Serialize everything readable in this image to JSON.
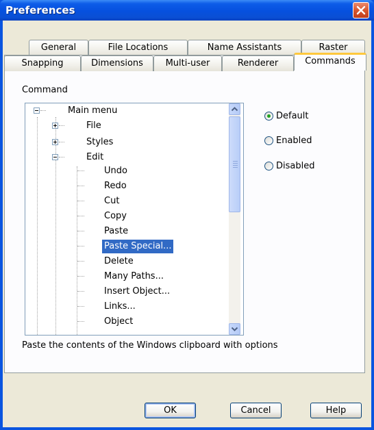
{
  "window": {
    "title": "Preferences"
  },
  "tabs_back": [
    "General",
    "File Locations",
    "Name Assistants",
    "Raster"
  ],
  "tabs_front": [
    "Snapping",
    "Dimensions",
    "Multi-user",
    "Renderer",
    "Commands"
  ],
  "active_tab": "Commands",
  "command_label": "Command",
  "tree": {
    "root": "Main menu",
    "children": [
      "File",
      "Styles",
      "Edit"
    ],
    "edit_items": [
      "Undo",
      "Redo",
      "Cut",
      "Copy",
      "Paste",
      "Paste Special...",
      "Delete",
      "Many Paths...",
      "Insert Object...",
      "Links...",
      "Object"
    ],
    "selected": "Paste Special..."
  },
  "radios": {
    "default": "Default",
    "enabled": "Enabled",
    "disabled": "Disabled",
    "selected": "Default"
  },
  "description": "Paste the contents of the Windows clipboard with options",
  "buttons": {
    "ok": "OK",
    "cancel": "Cancel",
    "help": "Help"
  },
  "colors": {
    "title_bar": "#0A55E0",
    "selection": "#316AC5",
    "active_tab_accent": "#FFC83C",
    "dialog_bg": "#ECE9D8"
  },
  "icons": {
    "close": "close-x-icon",
    "scroll_up": "chevron-up-icon",
    "scroll_down": "chevron-down-icon"
  }
}
